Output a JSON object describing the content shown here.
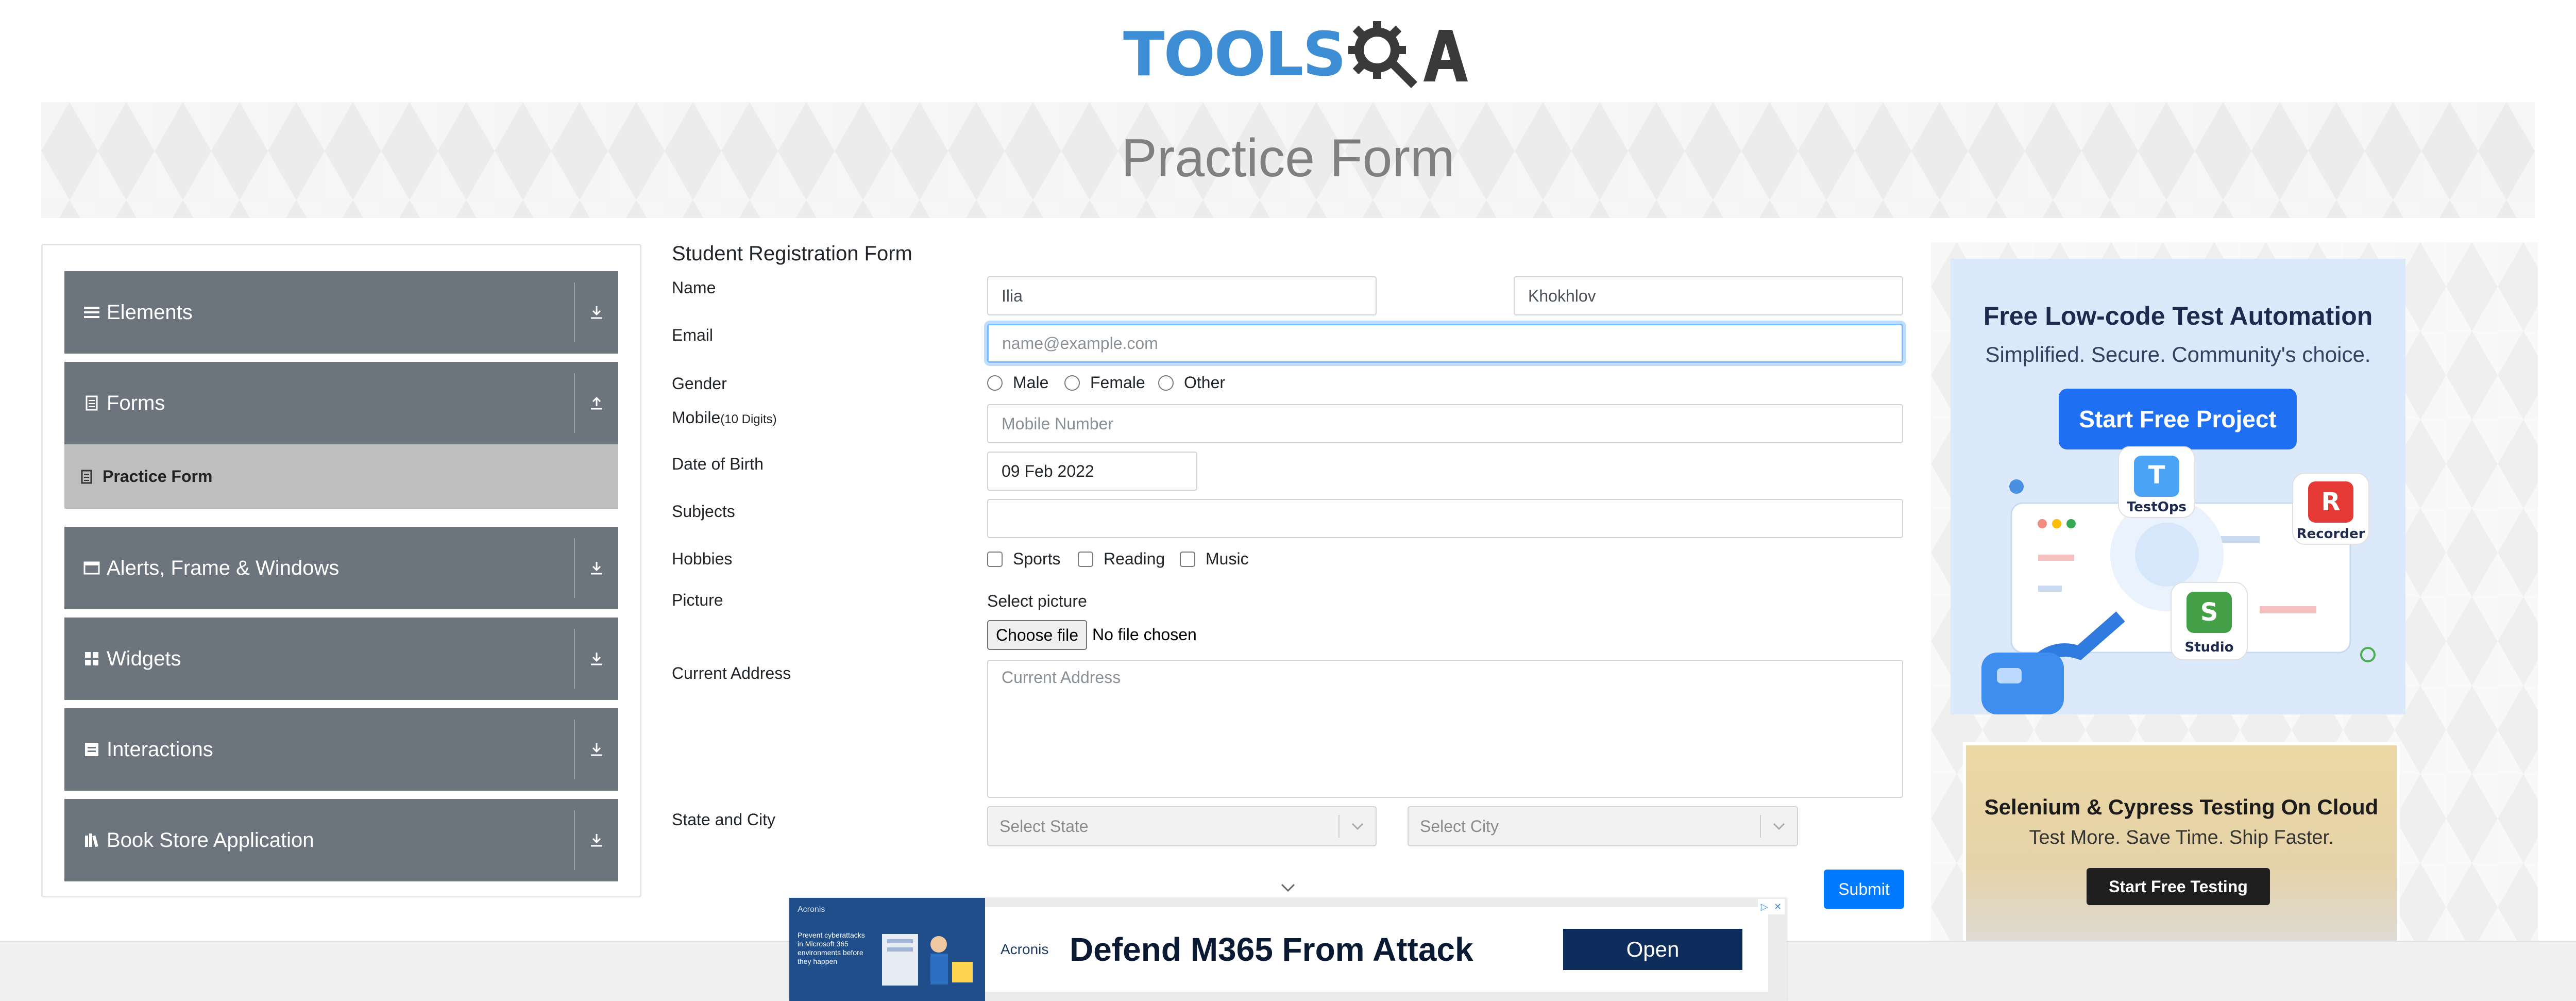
{
  "header": {
    "logo_tools": "TOOLS",
    "logo_qa": "QA",
    "page_title": "Practice Form"
  },
  "sidebar": {
    "groups": [
      {
        "label": "Elements",
        "icon": "list-icon",
        "toggle": "download-arrow-icon"
      },
      {
        "label": "Forms",
        "icon": "form-doc-icon",
        "toggle": "upload-arrow-icon"
      },
      {
        "label": "Alerts, Frame & Windows",
        "icon": "window-icon",
        "toggle": "download-arrow-icon"
      },
      {
        "label": "Widgets",
        "icon": "widgets-grid-icon",
        "toggle": "download-arrow-icon"
      },
      {
        "label": "Interactions",
        "icon": "interactions-icon",
        "toggle": "download-arrow-icon"
      },
      {
        "label": "Book Store Application",
        "icon": "books-icon",
        "toggle": "download-arrow-icon"
      }
    ],
    "active_item": {
      "label": "Practice Form",
      "icon": "form-icon"
    }
  },
  "form": {
    "title": "Student Registration Form",
    "name_label": "Name",
    "first_name": "Ilia",
    "last_name": "Khokhlov",
    "email_label": "Email",
    "email_placeholder": "name@example.com",
    "gender_label": "Gender",
    "gender_options": [
      "Male",
      "Female",
      "Other"
    ],
    "mobile_label": "Mobile",
    "mobile_hint": "(10 Digits)",
    "mobile_placeholder": "Mobile Number",
    "dob_label": "Date of Birth",
    "dob_value": "09 Feb 2022",
    "subjects_label": "Subjects",
    "hobbies_label": "Hobbies",
    "hobbies_options": [
      "Sports",
      "Reading",
      "Music"
    ],
    "picture_label": "Picture",
    "select_picture": "Select picture",
    "choose_file": "Choose file",
    "file_status": "No file chosen",
    "address_label": "Current Address",
    "address_placeholder": "Current Address",
    "state_city_label": "State and City",
    "state_placeholder": "Select State",
    "city_placeholder": "Select City",
    "submit": "Submit"
  },
  "ads": {
    "ad1": {
      "title": "Free Low-code Test Automation",
      "subtitle": "Simplified. Secure. Community's choice.",
      "button": "Start Free Project",
      "products": [
        "TestOps",
        "Recorder",
        "Studio"
      ]
    },
    "ad2": {
      "title": "Selenium & Cypress Testing On Cloud",
      "subtitle": "Test More. Save Time. Ship Faster.",
      "button": "Start Free Testing"
    },
    "bottom": {
      "brand": "Acronis",
      "small_text": "Prevent cyberattacks in Microsoft 365 environments before they happen",
      "headline": "Defend M365 From Attack",
      "button": "Open"
    }
  },
  "colors": {
    "sidebar_group": "#6c757d",
    "sidebar_active": "#bfbfbf",
    "primary": "#007bff",
    "logo_blue": "#3d8ed5"
  }
}
